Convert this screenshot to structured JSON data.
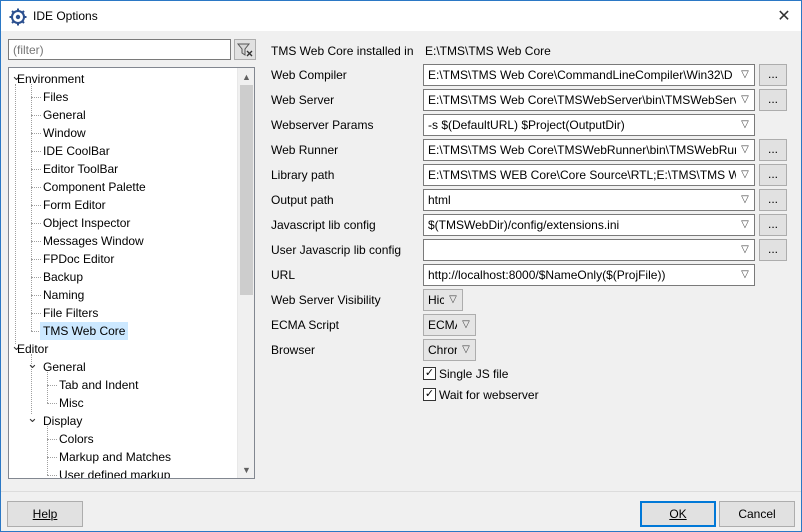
{
  "window": {
    "title": "IDE Options",
    "close_symbol": "✕"
  },
  "filter": {
    "placeholder": "(filter)",
    "icon": "filter-clear-icon"
  },
  "tree": {
    "items": [
      {
        "label": "Environment",
        "level": 0,
        "expanded": true
      },
      {
        "label": "Files",
        "level": 1
      },
      {
        "label": "General",
        "level": 1
      },
      {
        "label": "Window",
        "level": 1
      },
      {
        "label": "IDE CoolBar",
        "level": 1
      },
      {
        "label": "Editor ToolBar",
        "level": 1
      },
      {
        "label": "Component Palette",
        "level": 1
      },
      {
        "label": "Form Editor",
        "level": 1
      },
      {
        "label": "Object Inspector",
        "level": 1
      },
      {
        "label": "Messages Window",
        "level": 1
      },
      {
        "label": "FPDoc Editor",
        "level": 1
      },
      {
        "label": "Backup",
        "level": 1
      },
      {
        "label": "Naming",
        "level": 1
      },
      {
        "label": "File Filters",
        "level": 1
      },
      {
        "label": "TMS Web Core",
        "level": 1,
        "selected": true
      },
      {
        "label": "Editor",
        "level": 0,
        "expanded": true
      },
      {
        "label": "General",
        "level": 1,
        "expanded": true
      },
      {
        "label": "Tab and Indent",
        "level": 2
      },
      {
        "label": "Misc",
        "level": 2
      },
      {
        "label": "Display",
        "level": 1,
        "expanded": true
      },
      {
        "label": "Colors",
        "level": 2
      },
      {
        "label": "Markup and Matches",
        "level": 2
      },
      {
        "label": "User defined markup",
        "level": 2
      }
    ]
  },
  "settings": {
    "installed_label": "TMS Web Core installed in",
    "installed_value": "E:\\TMS\\TMS Web Core",
    "web_compiler": {
      "label": "Web Compiler",
      "value": "E:\\TMS\\TMS Web Core\\CommandLineCompiler\\Win32\\D"
    },
    "web_server": {
      "label": "Web Server",
      "value": "E:\\TMS\\TMS Web Core\\TMSWebServer\\bin\\TMSWebServe"
    },
    "webserver_params": {
      "label": "Webserver Params",
      "value": "-s $(DefaultURL) $Project(OutputDir)"
    },
    "web_runner": {
      "label": "Web Runner",
      "value": "E:\\TMS\\TMS Web Core\\TMSWebRunner\\bin\\TMSWebRur"
    },
    "library_path": {
      "label": "Library path",
      "value": "E:\\TMS\\TMS WEB Core\\Core Source\\RTL;E:\\TMS\\TMS WEI"
    },
    "output_path": {
      "label": "Output path",
      "value": "html"
    },
    "js_lib_config": {
      "label": "Javascript lib config",
      "value": "$(TMSWebDir)/config/extensions.ini"
    },
    "user_js_lib_config": {
      "label": "User Javascrip lib config",
      "value": ""
    },
    "url": {
      "label": "URL",
      "value": "http://localhost:8000/$NameOnly($(ProjFile))"
    },
    "web_server_visibility": {
      "label": "Web Server Visibility",
      "value": "Hic"
    },
    "ecma_script": {
      "label": "ECMA Script",
      "value": "ECMA"
    },
    "browser": {
      "label": "Browser",
      "value": "Chror"
    },
    "single_js_file": {
      "label": "Single JS file",
      "checked": true
    },
    "wait_for_webserver": {
      "label": "Wait for webserver",
      "checked": true
    },
    "browse_label": "..."
  },
  "buttons": {
    "help": "Help",
    "ok": "OK",
    "cancel": "Cancel"
  },
  "colors": {
    "selection": "#cce8ff",
    "default_button_border": "#0078d7"
  }
}
